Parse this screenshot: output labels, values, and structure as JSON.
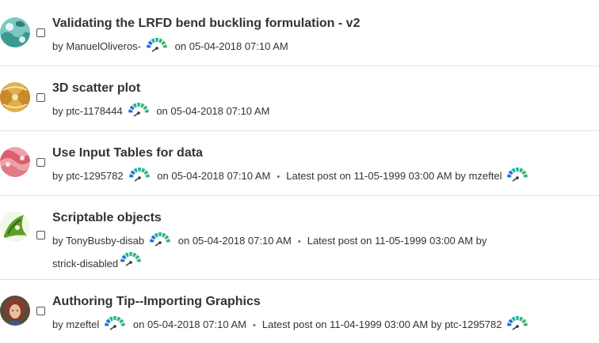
{
  "topics": [
    {
      "title": "Validating the LRFD bend buckling formulation - v2",
      "by": "by",
      "author": "ManuelOliveros-",
      "on_date": "on 05-04-2018 07:10 AM",
      "rank_icon": "rank-gauge-icon",
      "avatar_icon": "teal-pattern-avatar"
    },
    {
      "title": "3D scatter plot",
      "by": "by",
      "author": "ptc-1178444",
      "on_date": "on 05-04-2018 07:10 AM",
      "rank_icon": "rank-gauge-icon",
      "avatar_icon": "gold-pattern-avatar"
    },
    {
      "title": "Use Input Tables for data",
      "by": "by",
      "author": "ptc-1295782",
      "on_date": "on 05-04-2018 07:10 AM",
      "latest_post": "Latest post on 11-05-1999 03:00 AM by",
      "latest_author": "mzeftel",
      "rank_icon": "rank-gauge-icon",
      "avatar_icon": "pink-pattern-avatar"
    },
    {
      "title": "Scriptable objects",
      "by": "by",
      "author": "TonyBusby-disab",
      "on_date": "on 05-04-2018 07:10 AM",
      "latest_post": "Latest post on 11-05-1999 03:00 AM by",
      "latest_author": "strick-disabled",
      "rank_icon": "rank-gauge-icon",
      "avatar_icon": "green-pattern-avatar"
    },
    {
      "title": "Authoring Tip--Importing Graphics",
      "by": "by",
      "author": "mzeftel",
      "on_date": "on 05-04-2018 07:10 AM",
      "latest_post": "Latest post on 11-04-1999 03:00 AM by",
      "latest_author": "ptc-1295782",
      "rank_icon": "rank-gauge-icon",
      "avatar_icon": "photo-avatar"
    }
  ],
  "separator": "•",
  "colors": {
    "teal_avatar": "#5fb8b0",
    "gold_avatar": "#d9a441",
    "pink_avatar": "#e9848f",
    "green_avatar": "#6aa832",
    "rank_blue": "#1e6fd9",
    "rank_green": "#3cb371",
    "rank_teal": "#1fb5a8"
  }
}
